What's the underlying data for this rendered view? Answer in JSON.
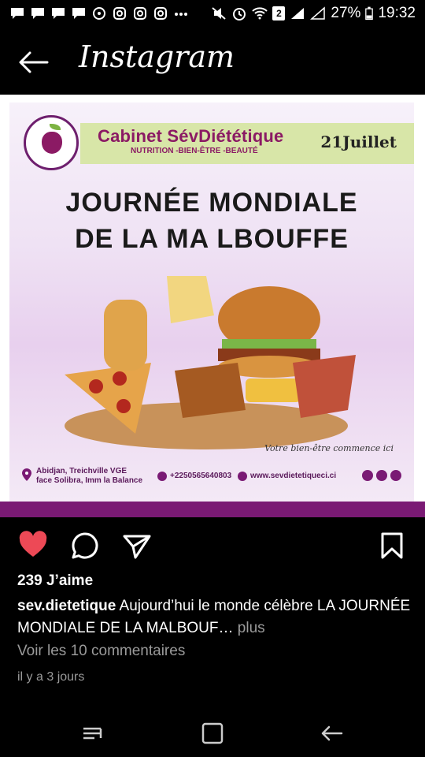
{
  "status_bar": {
    "notification_icons": [
      "message-icon",
      "message-icon",
      "message-icon",
      "message-icon",
      "whatsapp-icon",
      "instagram-icon",
      "instagram-icon",
      "instagram-icon",
      "more-dots-icon"
    ],
    "sim_badge": "2",
    "battery": "27%",
    "time": "19:32"
  },
  "header": {
    "title": "Instagram"
  },
  "post": {
    "brand_name": "Cabinet SévDiététique",
    "brand_tagline": "NUTRITION -BIEN-ÊTRE -BEAUTÉ",
    "date": "21Juillet",
    "headline_line1": "JOURNÉE MONDIALE",
    "headline_line2": "DE LA MA LBOUFFE",
    "slogan": "Votre bien-être commence ici",
    "address_line1": "Abidjan, Treichville VGE",
    "address_line2": "face Solibra, Imm la Balance",
    "phone": "+2250565640803",
    "website": "www.sevdietetiqueci.ci"
  },
  "likes": "239 J’aime",
  "caption": {
    "username": "sev.dietetique",
    "text": "Aujourd’hui le monde célèbre LA JOURNÉE MONDIALE DE LA MALBOUF…",
    "more": "plus"
  },
  "comments_link": "Voir les 10 commentaires",
  "timestamp": "il y a 3 jours",
  "colors": {
    "brand": "#8b1a64",
    "like_red": "#ed4956",
    "band": "#d8e6a8"
  }
}
